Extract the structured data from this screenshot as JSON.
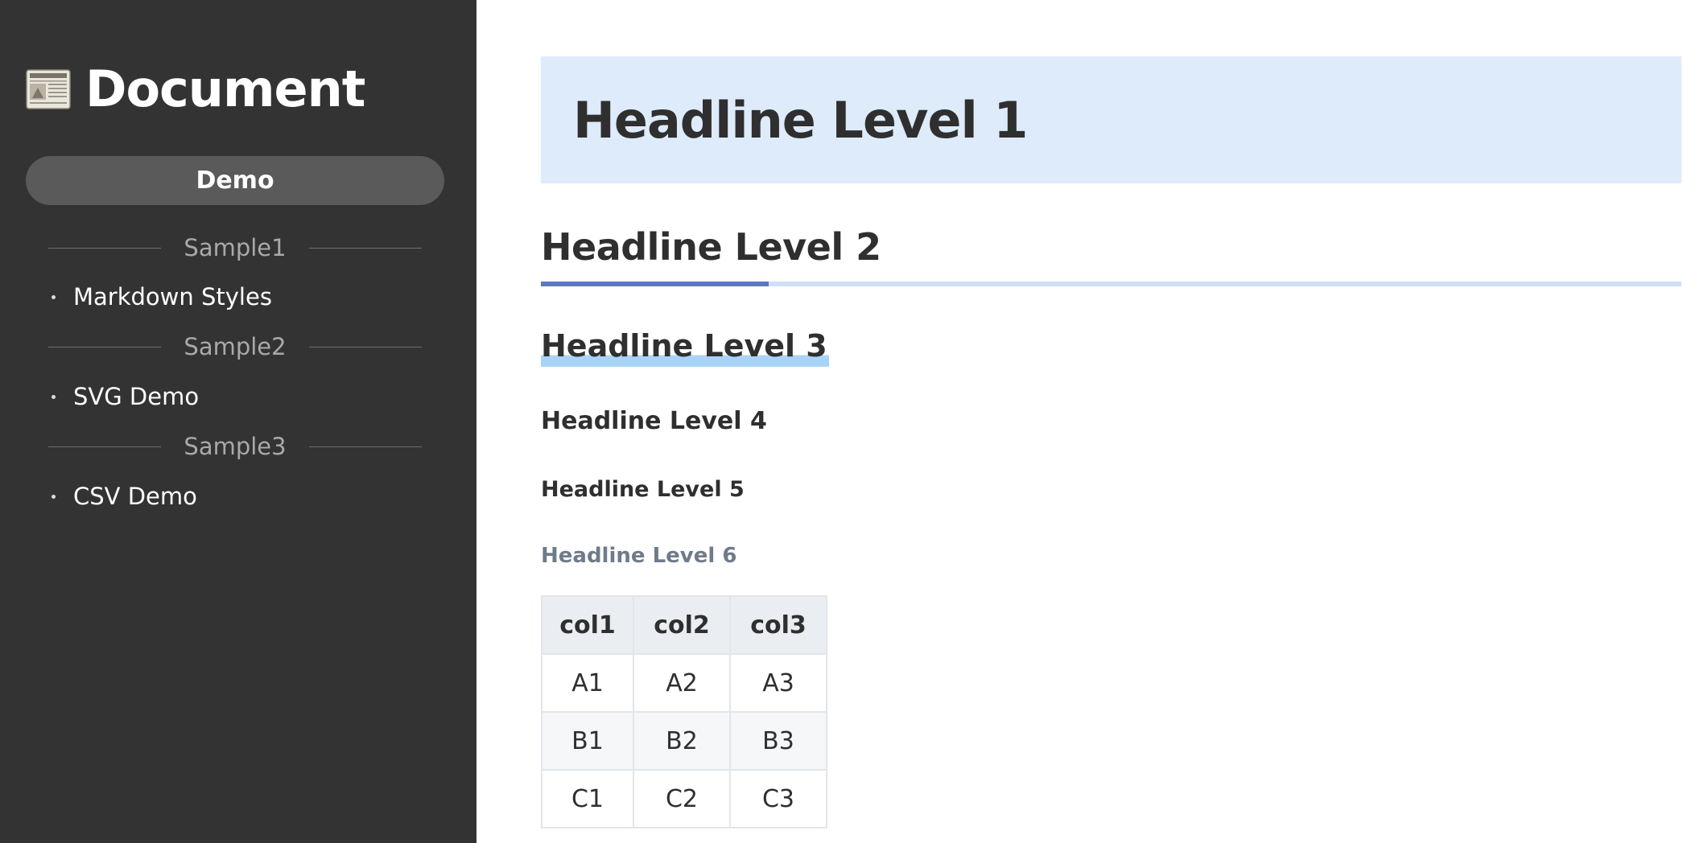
{
  "sidebar": {
    "brand": {
      "icon": "newspaper-icon",
      "title": "Document"
    },
    "active_group": "Demo",
    "sections": [
      {
        "label": "Sample1",
        "items": [
          "Markdown Styles"
        ]
      },
      {
        "label": "Sample2",
        "items": [
          "SVG Demo"
        ]
      },
      {
        "label": "Sample3",
        "items": [
          "CSV Demo"
        ]
      }
    ]
  },
  "content": {
    "h1": "Headline Level 1",
    "h2": "Headline Level 2",
    "h3": "Headline Level 3",
    "h4": "Headline Level 4",
    "h5": "Headline Level 5",
    "h6": "Headline Level 6",
    "table": {
      "headers": [
        "col1",
        "col2",
        "col3"
      ],
      "rows": [
        [
          "A1",
          "A2",
          "A3"
        ],
        [
          "B1",
          "B2",
          "B3"
        ],
        [
          "C1",
          "C2",
          "C3"
        ]
      ]
    }
  },
  "colors": {
    "sidebar_bg": "#333333",
    "pill_bg": "#5a5a5a",
    "h1_box_bg": "#deebfb",
    "h2_accent": "#5b77bf",
    "h2_rule": "#cfe0f6",
    "h3_highlight": "#a9d4f7",
    "h6_text": "#6f7b8a"
  }
}
